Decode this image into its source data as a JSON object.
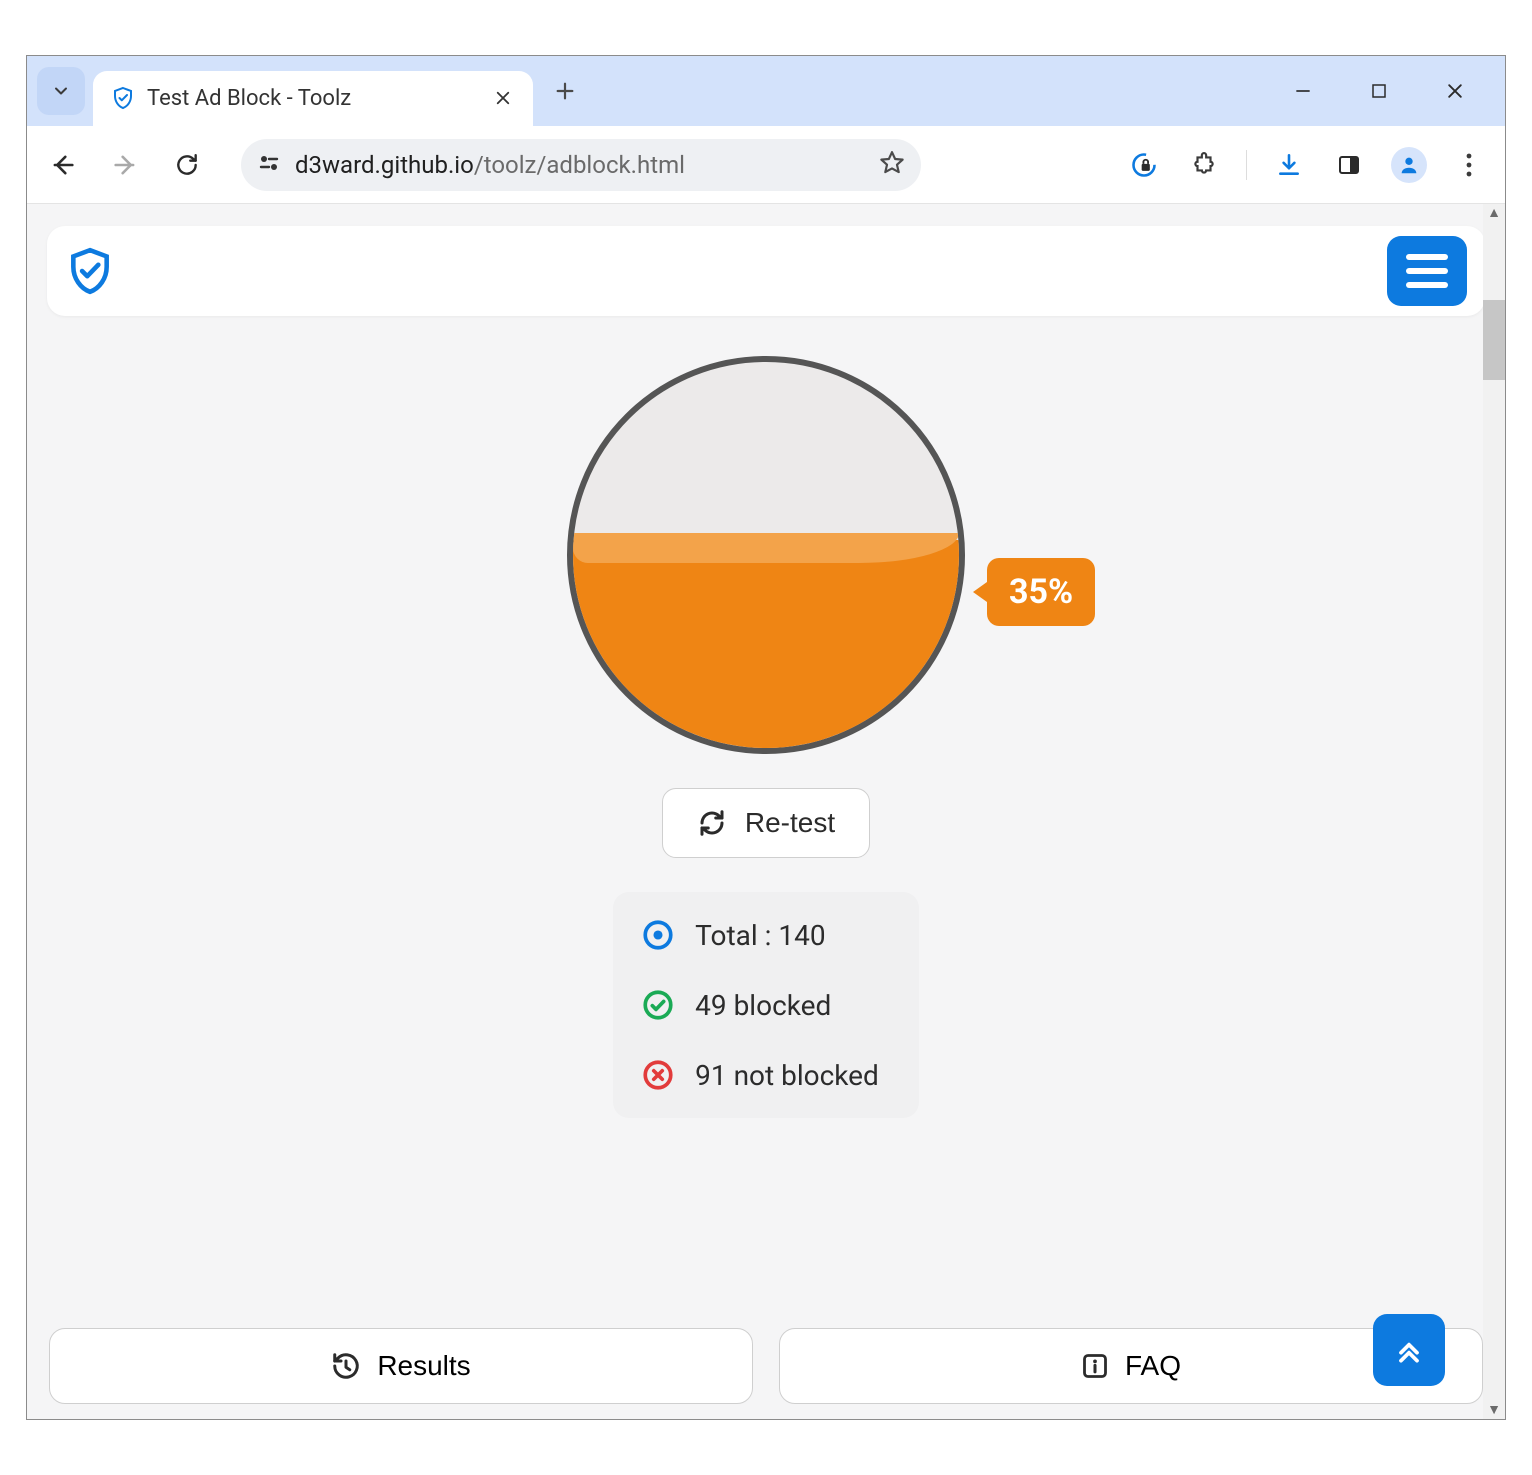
{
  "browser": {
    "tab_title": "Test Ad Block - Toolz",
    "url_host": "d3ward.github.io",
    "url_path": "/toolz/adblock.html"
  },
  "gauge": {
    "percent_label": "35%",
    "fill_percent": 35,
    "fill_color": "#ef8514"
  },
  "retest": {
    "label": "Re-test"
  },
  "stats": {
    "total_label": "Total : 140",
    "total": 140,
    "blocked_label": "49 blocked",
    "blocked": 49,
    "not_blocked_label": "91 not blocked",
    "not_blocked": 91
  },
  "bottom": {
    "results_label": "Results",
    "faq_label": "FAQ"
  },
  "colors": {
    "accent": "#0d7adf",
    "total": "#0d7adf",
    "blocked": "#1aaa55",
    "not_blocked": "#e23b3b"
  }
}
